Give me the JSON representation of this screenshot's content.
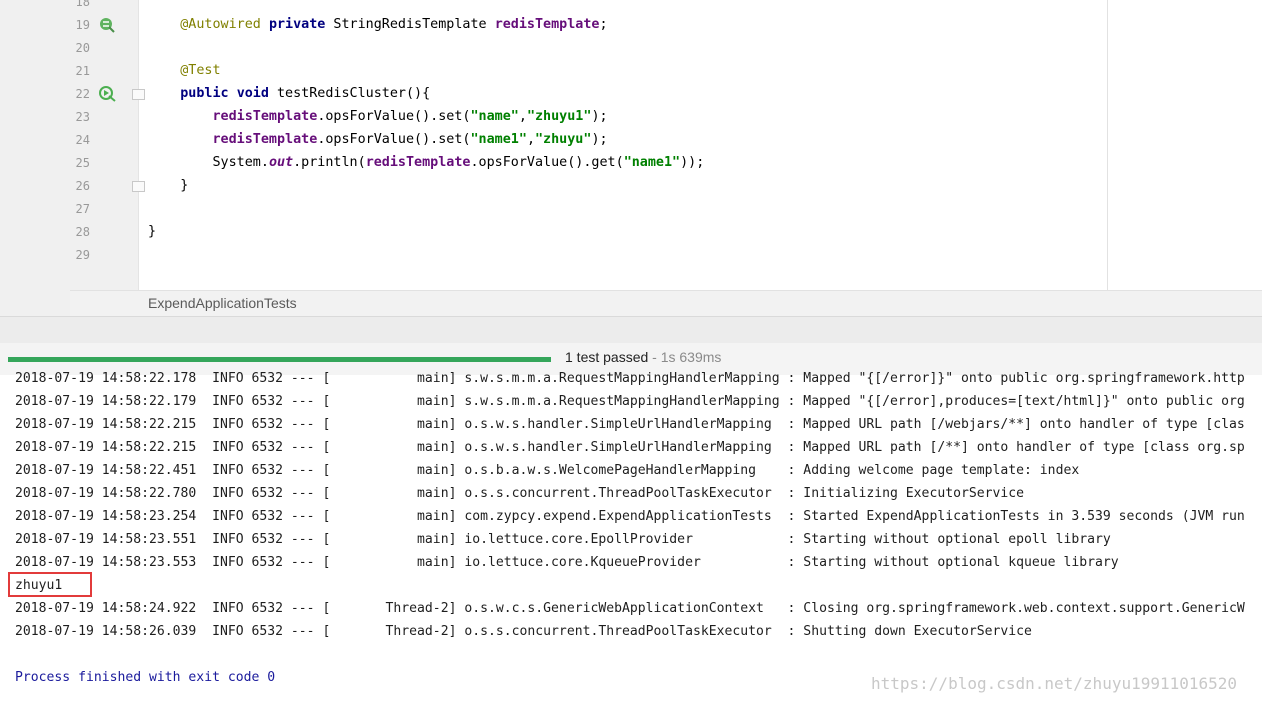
{
  "editor": {
    "lines": [
      {
        "num": "18"
      },
      {
        "num": "19",
        "segments": [
          [
            "ann",
            "@Autowired"
          ],
          [
            "plain",
            " "
          ],
          [
            "kw",
            "private"
          ],
          [
            "plain",
            " StringRedisTemplate "
          ],
          [
            "field",
            "redisTemplate"
          ],
          [
            "plain",
            ";"
          ]
        ],
        "indent": "    "
      },
      {
        "num": "20"
      },
      {
        "num": "21",
        "segments": [
          [
            "ann",
            "@Test"
          ]
        ],
        "indent": "    "
      },
      {
        "num": "22",
        "segments": [
          [
            "kw",
            "public"
          ],
          [
            "plain",
            " "
          ],
          [
            "kw",
            "void"
          ],
          [
            "plain",
            " testRedisCluster(){"
          ]
        ],
        "indent": "    "
      },
      {
        "num": "23",
        "segments": [
          [
            "field",
            "redisTemplate"
          ],
          [
            "plain",
            ".opsForValue().set("
          ],
          [
            "str",
            "\"name\""
          ],
          [
            "plain",
            ","
          ],
          [
            "str",
            "\"zhuyu1\""
          ],
          [
            "plain",
            ");"
          ]
        ],
        "indent": "        "
      },
      {
        "num": "24",
        "segments": [
          [
            "field",
            "redisTemplate"
          ],
          [
            "plain",
            ".opsForValue().set("
          ],
          [
            "str",
            "\"name1\""
          ],
          [
            "plain",
            ","
          ],
          [
            "str",
            "\"zhuyu\""
          ],
          [
            "plain",
            ");"
          ]
        ],
        "indent": "        "
      },
      {
        "num": "25",
        "segments": [
          [
            "plain",
            "System."
          ],
          [
            "static",
            "out"
          ],
          [
            "plain",
            ".println("
          ],
          [
            "field",
            "redisTemplate"
          ],
          [
            "plain",
            ".opsForValue().get("
          ],
          [
            "str",
            "\"name1\""
          ],
          [
            "plain",
            "));"
          ]
        ],
        "indent": "        "
      },
      {
        "num": "26",
        "segments": [
          [
            "plain",
            "}"
          ]
        ],
        "indent": "    "
      },
      {
        "num": "27"
      },
      {
        "num": "28",
        "segments": [
          [
            "plain",
            "}"
          ]
        ],
        "indent": ""
      },
      {
        "num": "29"
      }
    ],
    "tab_title": "ExpendApplicationTests"
  },
  "status": {
    "passed": "1 test passed",
    "time": " - 1s 639ms",
    "progress_fraction": 1.0
  },
  "console": {
    "lines": [
      "2018-07-19 14:58:22.178  INFO 6532 --- [           main] s.w.s.m.m.a.RequestMappingHandlerMapping : Mapped \"{[/error]}\" onto public org.springframework.http",
      "2018-07-19 14:58:22.179  INFO 6532 --- [           main] s.w.s.m.m.a.RequestMappingHandlerMapping : Mapped \"{[/error],produces=[text/html]}\" onto public org",
      "2018-07-19 14:58:22.215  INFO 6532 --- [           main] o.s.w.s.handler.SimpleUrlHandlerMapping  : Mapped URL path [/webjars/**] onto handler of type [clas",
      "2018-07-19 14:58:22.215  INFO 6532 --- [           main] o.s.w.s.handler.SimpleUrlHandlerMapping  : Mapped URL path [/**] onto handler of type [class org.sp",
      "2018-07-19 14:58:22.451  INFO 6532 --- [           main] o.s.b.a.w.s.WelcomePageHandlerMapping    : Adding welcome page template: index",
      "2018-07-19 14:58:22.780  INFO 6532 --- [           main] o.s.s.concurrent.ThreadPoolTaskExecutor  : Initializing ExecutorService",
      "2018-07-19 14:58:23.254  INFO 6532 --- [           main] com.zypcy.expend.ExpendApplicationTests  : Started ExpendApplicationTests in 3.539 seconds (JVM run",
      "2018-07-19 14:58:23.551  INFO 6532 --- [           main] io.lettuce.core.EpollProvider            : Starting without optional epoll library",
      "2018-07-19 14:58:23.553  INFO 6532 --- [           main] io.lettuce.core.KqueueProvider           : Starting without optional kqueue library",
      "zhuyu1",
      "2018-07-19 14:58:24.922  INFO 6532 --- [       Thread-2] o.s.w.c.s.GenericWebApplicationContext   : Closing org.springframework.web.context.support.GenericW",
      "2018-07-19 14:58:26.039  INFO 6532 --- [       Thread-2] o.s.s.concurrent.ThreadPoolTaskExecutor  : Shutting down ExecutorService"
    ],
    "process_finished": "Process finished with exit code 0"
  },
  "watermark": "https://blog.csdn.net/zhuyu19911016520",
  "colors": {
    "progress": "#35a65b",
    "highlight": "#e23b3b",
    "keyword": "#000080",
    "annotation": "#808000",
    "string": "#008000",
    "field": "#660e7a"
  }
}
